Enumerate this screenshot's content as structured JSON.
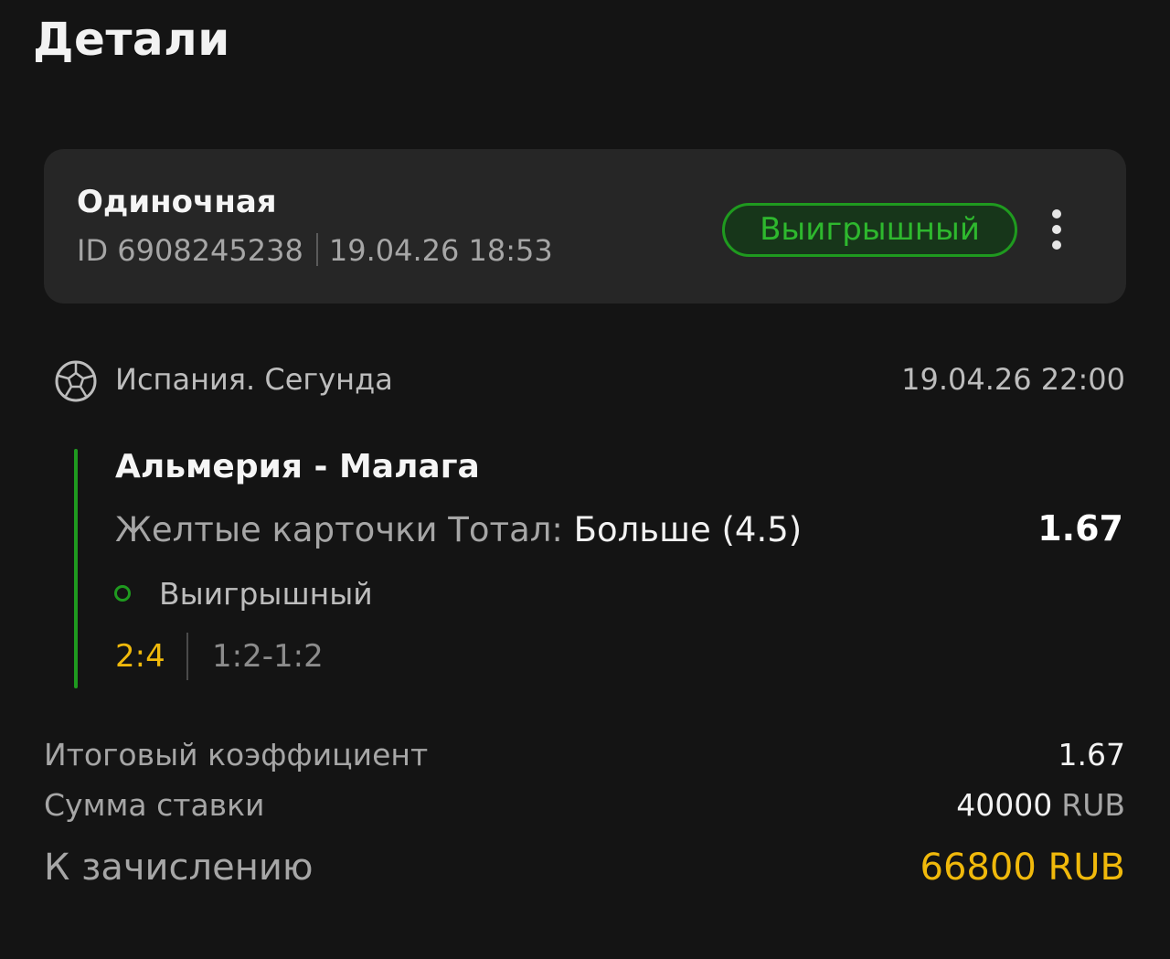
{
  "page": {
    "title": "Детали"
  },
  "bet": {
    "type": "Одиночная",
    "id_label": "ID 6908245238",
    "placed_at": "19.04.26 18:53",
    "status": "Выигрышный"
  },
  "event": {
    "sport_icon": "soccer-ball-icon",
    "league": "Испания. Сегунда",
    "start": "19.04.26 22:00",
    "match": "Альмерия - Малага",
    "market": "Желтые карточки Тотал: ",
    "selection": "Больше (4.5)",
    "odds": "1.67",
    "result": "Выигрышный",
    "final_score": "2:4",
    "period_score": "1:2-1:2"
  },
  "summary": {
    "total_odds_label": "Итоговый коэффициент",
    "total_odds_value": "1.67",
    "stake_label": "Сумма ставки",
    "stake_amount": "40000",
    "stake_currency": "RUB",
    "payout_label": "К зачислению",
    "payout_value": "66800 RUB"
  },
  "colors": {
    "background": "#141414",
    "card": "#262626",
    "win_green": "#1f9a1f",
    "accent_yellow": "#f0b90b"
  }
}
